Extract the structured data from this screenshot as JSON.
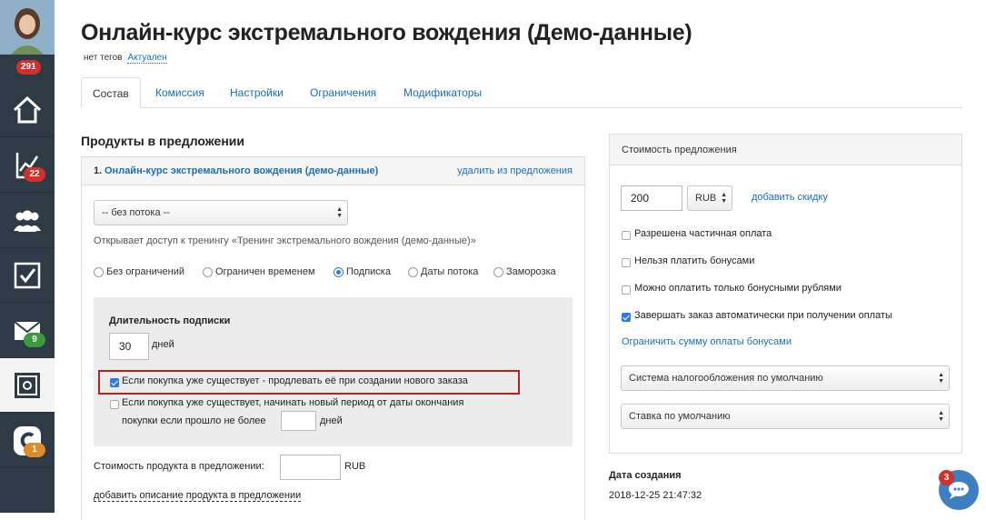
{
  "sidebar": {
    "avatar_badge": "291",
    "items": [
      {
        "name": "home-icon",
        "badge": ""
      },
      {
        "name": "chart-icon",
        "badge": "22"
      },
      {
        "name": "users-icon",
        "badge": ""
      },
      {
        "name": "tasks-icon",
        "badge": ""
      },
      {
        "name": "mail-icon",
        "badge": "9"
      },
      {
        "name": "safe-icon",
        "badge": ""
      },
      {
        "name": "brand-icon",
        "badge": "1"
      }
    ],
    "colors": {
      "bg": "#2e3a45",
      "badge_red": "#d0312d",
      "badge_green": "#3d9a3a",
      "badge_orange": "#e08a2a"
    }
  },
  "header": {
    "title": "Онлайн-курс экстремального вождения (Демо-данные)",
    "no_tags": "нет тегов",
    "status_link": "Актуален"
  },
  "tabs": [
    {
      "label": "Состав",
      "active": true
    },
    {
      "label": "Комиссия",
      "active": false
    },
    {
      "label": "Настройки",
      "active": false
    },
    {
      "label": "Ограничения",
      "active": false
    },
    {
      "label": "Модификаторы",
      "active": false
    }
  ],
  "products": {
    "section_title": "Продукты в предложении",
    "item": {
      "number": "1.",
      "name": "Онлайн-курс экстремального вождения (демо-данные)",
      "remove_link": "удалить из предложения",
      "stream_select": "-- без потока --",
      "access_text": "Открывает доступ к тренингу «Тренинг экстремального вождения (демо-данные)»",
      "radios": [
        {
          "label": "Без ограничений",
          "checked": false
        },
        {
          "label": "Ограничен временем",
          "checked": false
        },
        {
          "label": "Подписка",
          "checked": true
        },
        {
          "label": "Даты потока",
          "checked": false
        },
        {
          "label": "Заморозка",
          "checked": false
        }
      ],
      "subscription": {
        "label": "Длительность подписки",
        "duration_value": "30",
        "duration_unit": "дней",
        "option1": {
          "text": "Если покупка уже существует - продлевать её при создании нового заказа",
          "checked": true
        },
        "option2": {
          "text_line1": "Если покупка уже существует, начинать новый период от даты окончания",
          "text_line2": "покупки если прошло не более",
          "unit": "дней",
          "value": "",
          "checked": false
        }
      },
      "price_label": "Стоимость продукта в предложении:",
      "price_value": "",
      "price_currency": "RUB",
      "add_description": "добавить описание продукта в предложении"
    }
  },
  "offer_price": {
    "title": "Стоимость предложения",
    "amount": "200",
    "currency": "RUB",
    "add_discount": "добавить скидку",
    "checkboxes": [
      {
        "label": "Разрешена частичная оплата",
        "checked": false
      },
      {
        "label": "Нельзя платить бонусами",
        "checked": false
      },
      {
        "label": "Можно оплатить только бонусными рублями",
        "checked": false
      },
      {
        "label": "Завершать заказ автоматически при получении оплаты",
        "checked": true
      }
    ],
    "limit_bonus_link": "Ограничить сумму оплаты бонусами",
    "tax_select": "Система налогообложения по умолчанию",
    "rate_select": "Ставка по умолчанию"
  },
  "created": {
    "label": "Дата создания",
    "value": "2018-12-25 21:47:32"
  },
  "chat": {
    "badge": "3"
  }
}
